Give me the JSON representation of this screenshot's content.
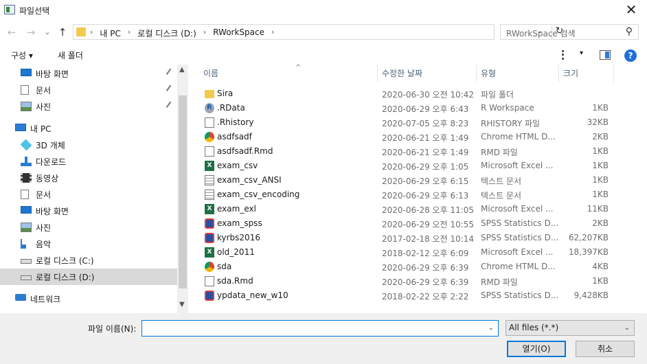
{
  "window": {
    "title": "파일선택",
    "close_glyph": "✕"
  },
  "nav": {
    "back_glyph": "←",
    "forward_glyph": "→",
    "recent_glyph": "⌄",
    "up_glyph": "↑",
    "breadcrumbs": [
      "내 PC",
      "로컬 디스크 (D:)",
      "RWorkSpace"
    ],
    "separator": "›",
    "refresh_glyph": "↻",
    "dropdown_glyph": "⌄",
    "search_placeholder": "RWorkSpace 검색",
    "search_glyph": "⚲"
  },
  "toolbar": {
    "organize": "구성 ▾",
    "new_folder": "새 폴더",
    "view_dropdown": "▾",
    "help": "?"
  },
  "sidebar": {
    "items": [
      {
        "label": "바탕 화면",
        "icon": "desktop-icon",
        "pinned": true
      },
      {
        "label": "문서",
        "icon": "documents-icon",
        "pinned": true
      },
      {
        "label": "사진",
        "icon": "pictures-icon",
        "pinned": true
      },
      {
        "label": "내 PC",
        "icon": "pc-icon",
        "pinned": false
      },
      {
        "label": "3D 개체",
        "icon": "3d-objects-icon",
        "pinned": false
      },
      {
        "label": "다운로드",
        "icon": "download-icon",
        "pinned": false
      },
      {
        "label": "동영상",
        "icon": "video-icon",
        "pinned": false
      },
      {
        "label": "문서",
        "icon": "documents-icon",
        "pinned": false
      },
      {
        "label": "바탕 화면",
        "icon": "desktop-icon",
        "pinned": false
      },
      {
        "label": "사진",
        "icon": "pictures-icon",
        "pinned": false
      },
      {
        "label": "음악",
        "icon": "music-icon",
        "pinned": false
      },
      {
        "label": "로컬 디스크 (C:)",
        "icon": "drive-icon",
        "pinned": false
      },
      {
        "label": "로컬 디스크 (D:)",
        "icon": "drive-icon",
        "pinned": false,
        "selected": true
      },
      {
        "label": "네트워크",
        "icon": "network-icon",
        "pinned": false
      }
    ],
    "scroll_up": "▲",
    "scroll_down": "▼"
  },
  "columns": {
    "name": "이름",
    "date": "수정한 날짜",
    "type": "유형",
    "size": "크기",
    "sort_indicator": "^"
  },
  "files": [
    {
      "name": "Sira",
      "date": "2020-06-30 오전 10:42",
      "type": "파일 폴더",
      "size": "",
      "icon": "folder"
    },
    {
      "name": ".RData",
      "date": "2020-06-29 오후 6:43",
      "type": "R Workspace",
      "size": "1KB",
      "icon": "r"
    },
    {
      "name": ".Rhistory",
      "date": "2020-07-05 오후 8:23",
      "type": "RHISTORY 파일",
      "size": "32KB",
      "icon": "doc"
    },
    {
      "name": "asdfsadf",
      "date": "2020-06-21 오후 1:49",
      "type": "Chrome HTML D...",
      "size": "2KB",
      "icon": "chrome"
    },
    {
      "name": "asdfsadf.Rmd",
      "date": "2020-06-21 오후 1:49",
      "type": "RMD 파일",
      "size": "1KB",
      "icon": "doc"
    },
    {
      "name": "exam_csv",
      "date": "2020-06-29 오후 1:05",
      "type": "Microsoft Excel ...",
      "size": "1KB",
      "icon": "excel"
    },
    {
      "name": "exam_csv_ANSI",
      "date": "2020-06-29 오후 6:15",
      "type": "텍스트 문서",
      "size": "1KB",
      "icon": "txt"
    },
    {
      "name": "exam_csv_encoding",
      "date": "2020-06-29 오후 6:13",
      "type": "텍스트 문서",
      "size": "1KB",
      "icon": "txt"
    },
    {
      "name": "exam_exl",
      "date": "2020-06-28 오후 11:05",
      "type": "Microsoft Excel ...",
      "size": "11KB",
      "icon": "excel"
    },
    {
      "name": "exam_spss",
      "date": "2020-06-29 오전 10:55",
      "type": "SPSS Statistics D...",
      "size": "2KB",
      "icon": "spss"
    },
    {
      "name": "kyrbs2016",
      "date": "2017-02-18 오전 10:14",
      "type": "SPSS Statistics D...",
      "size": "62,207KB",
      "icon": "spss"
    },
    {
      "name": "old_2011",
      "date": "2018-02-12 오후 6:09",
      "type": "Microsoft Excel ...",
      "size": "18,397KB",
      "icon": "excel"
    },
    {
      "name": "sda",
      "date": "2020-06-29 오후 6:39",
      "type": "Chrome HTML D...",
      "size": "4KB",
      "icon": "chrome"
    },
    {
      "name": "sda.Rmd",
      "date": "2020-06-29 오후 6:39",
      "type": "RMD 파일",
      "size": "1KB",
      "icon": "doc"
    },
    {
      "name": "ypdata_new_w10",
      "date": "2018-02-22 오후 2:22",
      "type": "SPSS Statistics D...",
      "size": "9,428KB",
      "icon": "spss"
    }
  ],
  "footer": {
    "filename_label": "파일 이름(N):",
    "filename_value": "",
    "filter_value": "All files (*.*)",
    "dropdown_glyph": "⌄",
    "open_label": "열기(O)",
    "cancel_label": "취소"
  },
  "colors": {
    "accent": "#0078d7",
    "selected_bg": "#d9d9d9",
    "folder": "#f3c94f"
  }
}
